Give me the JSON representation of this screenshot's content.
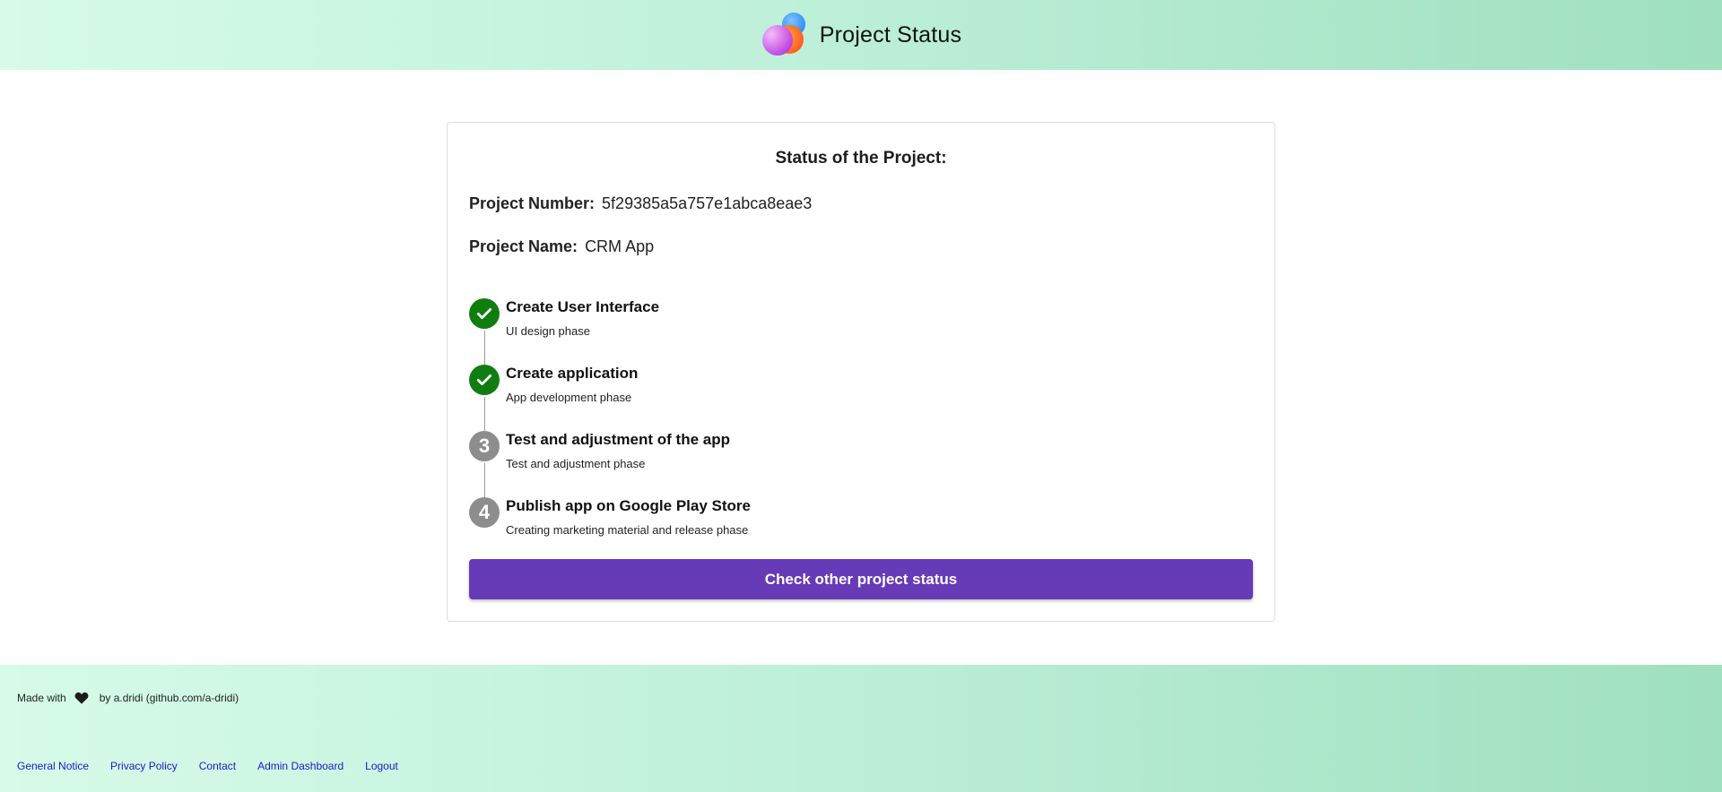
{
  "header": {
    "title": "Project Status",
    "logo_icon": "overlapping-circles-logo",
    "gradient_colors": [
      "#d6fbe9",
      "#9fe0bf"
    ]
  },
  "card": {
    "heading": "Status of the Project:",
    "project_number_label": "Project Number:",
    "project_number": "5f29385a5a757e1abca8eae3",
    "project_name_label": "Project Name:",
    "project_name": "CRM App"
  },
  "steps": [
    {
      "marker": "",
      "status": "done",
      "icon": "check-icon",
      "title": "Create User Interface",
      "subtitle": "UI design phase"
    },
    {
      "marker": "",
      "status": "done",
      "icon": "check-icon",
      "title": "Create application",
      "subtitle": "App development phase"
    },
    {
      "marker": "3",
      "status": "todo",
      "icon": "",
      "title": "Test and adjustment of the app",
      "subtitle": "Test and adjustment phase"
    },
    {
      "marker": "4",
      "status": "todo",
      "icon": "",
      "title": "Publish app on Google Play Store",
      "subtitle": "Creating marketing material and release phase"
    }
  ],
  "colors": {
    "done": "#0f7d0f",
    "todo": "#8d8d8d",
    "primary_button": "#673ab7",
    "link": "#1a1acb"
  },
  "cta": {
    "label": "Check other project status"
  },
  "footer": {
    "made_with_prefix": "Made with",
    "heart_icon": "heart-icon",
    "made_with_suffix": "by a.dridi (github.com/a-dridi)",
    "links": [
      "General Notice",
      "Privacy Policy",
      "Contact",
      "Admin Dashboard",
      "Logout"
    ]
  }
}
